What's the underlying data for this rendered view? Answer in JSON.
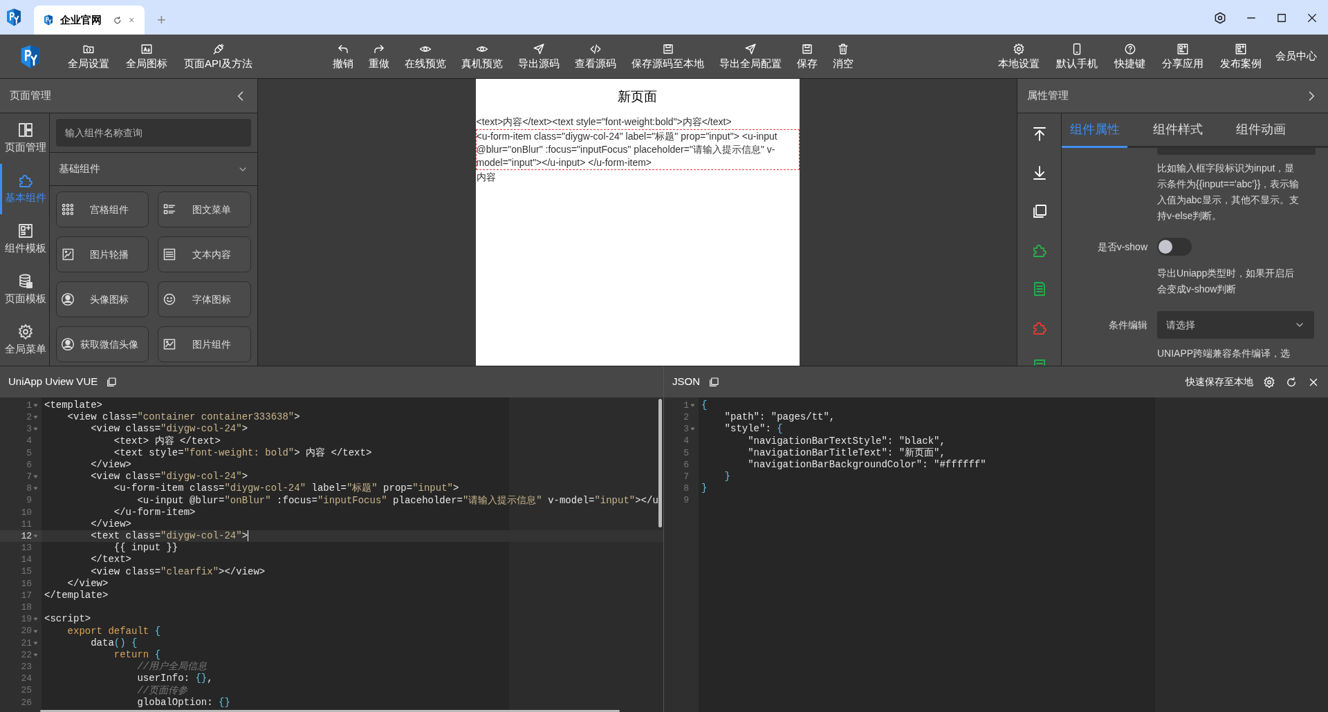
{
  "browser": {
    "tabs": [
      {
        "label": "企业官网",
        "selected": true
      }
    ],
    "new_tab": "+"
  },
  "toolbar": {
    "left": [
      {
        "label": "全局设置"
      },
      {
        "label": "全局图标"
      },
      {
        "label": "页面API及方法"
      }
    ],
    "middle": [
      {
        "label": "撤销"
      },
      {
        "label": "重做"
      },
      {
        "label": "在线预览"
      },
      {
        "label": "真机预览"
      },
      {
        "label": "导出源码"
      },
      {
        "label": "查看源码"
      },
      {
        "label": "保存源码至本地"
      },
      {
        "label": "导出全局配置"
      },
      {
        "label": "保存"
      },
      {
        "label": "消空"
      }
    ],
    "right": [
      {
        "label": "本地设置",
        "kind": "icon"
      },
      {
        "label": "默认手机",
        "kind": "icon"
      },
      {
        "label": "快捷键",
        "kind": "icon"
      },
      {
        "label": "分享应用",
        "kind": "icon"
      },
      {
        "label": "发布案例",
        "kind": "icon"
      },
      {
        "label": "会员中心",
        "kind": "text"
      }
    ]
  },
  "page_panel": {
    "title": "页面管理",
    "nav": [
      {
        "label": "页面管理",
        "selected": false
      },
      {
        "label": "基本组件",
        "selected": true
      },
      {
        "label": "组件模板",
        "selected": false
      },
      {
        "label": "页面模板",
        "selected": false
      },
      {
        "label": "全局菜单",
        "selected": false
      }
    ],
    "search": {
      "placeholder": "输入组件名称查询"
    },
    "group": {
      "title": "基础组件",
      "expanded": true
    },
    "components": [
      {
        "label": "宫格组件"
      },
      {
        "label": "图文菜单"
      },
      {
        "label": "图片轮播"
      },
      {
        "label": "文本内容"
      },
      {
        "label": "头像图标"
      },
      {
        "label": "字体图标"
      },
      {
        "label": "获取微信头像"
      },
      {
        "label": "图片组件"
      }
    ]
  },
  "preview": {
    "title": "新页面",
    "items": [
      {
        "text": "<text>内容</text><text style=\"font-weight:bold\">内容</text>",
        "selected": false
      },
      {
        "text": "<u-form-item class=\"diygw-col-24\" label=\"标题\" prop=\"input\"> <u-input @blur=\"onBlur\" :focus=\"inputFocus\" placeholder=\"请输入提示信息\" v-model=\"input\"></u-input> </u-form-item>",
        "selected": true
      },
      {
        "text": "内容",
        "selected": false
      }
    ]
  },
  "property_panel": {
    "title": "属性管理",
    "tabs": [
      {
        "label": "组件属性",
        "selected": true
      },
      {
        "label": "组件样式",
        "selected": false
      },
      {
        "label": "组件动画",
        "selected": false
      }
    ],
    "hint_1": "比如输入框字段标识为input，显示条件为{{input=='abc'}}，表示输入值为abc显示，其他不显示。支持v-else判断。",
    "vshow": {
      "label": "是否v-show",
      "on": false
    },
    "hint_2": "导出Uniapp类型时，如果开启后会变成v-show判断",
    "condition": {
      "label": "条件编辑",
      "placeholder": "请选择"
    },
    "hint_3": "UNIAPP跨端兼容条件编译，选"
  },
  "vue_editor": {
    "title": "UniApp Uview VUE",
    "lines": [
      {
        "n": "1",
        "fold": true,
        "active": false,
        "tokens": [
          {
            "kind": "plain",
            "text": "<template>"
          }
        ]
      },
      {
        "n": "2",
        "fold": true,
        "active": false,
        "tokens": [
          {
            "kind": "plain",
            "text": "    <view class="
          },
          {
            "kind": "string",
            "text": "\"container container333638\""
          },
          {
            "kind": "plain",
            "text": ">"
          }
        ]
      },
      {
        "n": "3",
        "fold": true,
        "active": false,
        "tokens": [
          {
            "kind": "plain",
            "text": "        <view class="
          },
          {
            "kind": "string",
            "text": "\"diygw-col-24\""
          },
          {
            "kind": "plain",
            "text": ">"
          }
        ]
      },
      {
        "n": "4",
        "fold": false,
        "active": false,
        "tokens": [
          {
            "kind": "plain",
            "text": "            <text> 内容 </text>"
          }
        ]
      },
      {
        "n": "5",
        "fold": false,
        "active": false,
        "tokens": [
          {
            "kind": "plain",
            "text": "            <text style="
          },
          {
            "kind": "string",
            "text": "\"font-weight: bold\""
          },
          {
            "kind": "plain",
            "text": "> 内容 </text>"
          }
        ]
      },
      {
        "n": "6",
        "fold": false,
        "active": false,
        "tokens": [
          {
            "kind": "plain",
            "text": "        </view>"
          }
        ]
      },
      {
        "n": "7",
        "fold": true,
        "active": false,
        "tokens": [
          {
            "kind": "plain",
            "text": "        <view class="
          },
          {
            "kind": "string",
            "text": "\"diygw-col-24\""
          },
          {
            "kind": "plain",
            "text": ">"
          }
        ]
      },
      {
        "n": "8",
        "fold": true,
        "active": false,
        "tokens": [
          {
            "kind": "plain",
            "text": "            <u-form-item class="
          },
          {
            "kind": "string",
            "text": "\"diygw-col-24\""
          },
          {
            "kind": "plain",
            "text": " label="
          },
          {
            "kind": "string",
            "text": "\"标题\""
          },
          {
            "kind": "plain",
            "text": " prop="
          },
          {
            "kind": "string",
            "text": "\"input\""
          },
          {
            "kind": "plain",
            "text": ">"
          }
        ]
      },
      {
        "n": "9",
        "fold": false,
        "active": false,
        "tokens": [
          {
            "kind": "plain",
            "text": "                <u-input @blur="
          },
          {
            "kind": "string",
            "text": "\"onBlur\""
          },
          {
            "kind": "plain",
            "text": " :focus="
          },
          {
            "kind": "string",
            "text": "\"inputFocus\""
          },
          {
            "kind": "plain",
            "text": " placeholder="
          },
          {
            "kind": "string",
            "text": "\"请输入提示信息\""
          },
          {
            "kind": "plain",
            "text": " v-model="
          },
          {
            "kind": "string",
            "text": "\"input\""
          },
          {
            "kind": "plain",
            "text": "></u"
          }
        ]
      },
      {
        "n": "10",
        "fold": false,
        "active": false,
        "tokens": [
          {
            "kind": "plain",
            "text": "            </u-form-item>"
          }
        ]
      },
      {
        "n": "11",
        "fold": false,
        "active": false,
        "tokens": [
          {
            "kind": "plain",
            "text": "        </view>"
          }
        ]
      },
      {
        "n": "12",
        "fold": true,
        "active": true,
        "tokens": [
          {
            "kind": "plain",
            "text": "        <text class="
          },
          {
            "kind": "string",
            "text": "\"diygw-col-24\""
          },
          {
            "kind": "plain",
            "text": ">"
          }
        ]
      },
      {
        "n": "13",
        "fold": false,
        "active": false,
        "tokens": [
          {
            "kind": "plain",
            "text": "            {{ input }}"
          }
        ]
      },
      {
        "n": "14",
        "fold": false,
        "active": false,
        "tokens": [
          {
            "kind": "plain",
            "text": "        </text>"
          }
        ]
      },
      {
        "n": "15",
        "fold": false,
        "active": false,
        "tokens": [
          {
            "kind": "plain",
            "text": "        <view class="
          },
          {
            "kind": "string",
            "text": "\"clearfix\""
          },
          {
            "kind": "plain",
            "text": "></view>"
          }
        ]
      },
      {
        "n": "16",
        "fold": false,
        "active": false,
        "tokens": [
          {
            "kind": "plain",
            "text": "    </view>"
          }
        ]
      },
      {
        "n": "17",
        "fold": false,
        "active": false,
        "tokens": [
          {
            "kind": "plain",
            "text": "</template>"
          }
        ]
      },
      {
        "n": "18",
        "fold": false,
        "active": false
      },
      {
        "n": "19",
        "fold": true,
        "active": false,
        "tokens": [
          {
            "kind": "plain",
            "text": "<script>"
          }
        ]
      },
      {
        "n": "20",
        "fold": true,
        "active": false,
        "tokens": [
          {
            "kind": "keyword",
            "text": "    export default"
          },
          {
            "kind": "brace",
            "text": " {"
          }
        ]
      },
      {
        "n": "21",
        "fold": true,
        "active": false,
        "tokens": [
          {
            "kind": "plain",
            "text": "        data"
          },
          {
            "kind": "brace",
            "text": "() {"
          }
        ]
      },
      {
        "n": "22",
        "fold": true,
        "active": false,
        "tokens": [
          {
            "kind": "keyword",
            "text": "            return"
          },
          {
            "kind": "brace",
            "text": " {"
          }
        ]
      },
      {
        "n": "23",
        "fold": false,
        "active": false,
        "tokens": [
          {
            "kind": "comment",
            "text": "                //用户全局信息"
          }
        ]
      },
      {
        "n": "24",
        "fold": false,
        "active": false,
        "tokens": [
          {
            "kind": "plain",
            "text": "                userInfo: "
          },
          {
            "kind": "brace",
            "text": "{}"
          },
          {
            "kind": "plain",
            "text": ","
          }
        ]
      },
      {
        "n": "25",
        "fold": false,
        "active": false,
        "tokens": [
          {
            "kind": "comment",
            "text": "                //页面传参"
          }
        ]
      },
      {
        "n": "26",
        "fold": false,
        "active": false,
        "tokens": [
          {
            "kind": "plain",
            "text": "                globalOption: "
          },
          {
            "kind": "brace",
            "text": "{}"
          }
        ]
      }
    ]
  },
  "json_editor": {
    "title": "JSON",
    "save_label": "快速保存至本地",
    "lines": [
      {
        "n": "1",
        "fold": true,
        "active": false,
        "tokens": [
          {
            "kind": "brace",
            "text": "{"
          }
        ]
      },
      {
        "n": "2",
        "fold": false,
        "active": false,
        "tokens": [
          {
            "kind": "plain",
            "text": "    \"path\": \"pages/tt\","
          }
        ]
      },
      {
        "n": "3",
        "fold": true,
        "active": false,
        "tokens": [
          {
            "kind": "plain",
            "text": "    \"style\": "
          },
          {
            "kind": "brace",
            "text": "{"
          }
        ]
      },
      {
        "n": "4",
        "fold": false,
        "active": false,
        "tokens": [
          {
            "kind": "plain",
            "text": "        \"navigationBarTextStyle\": \"black\","
          }
        ]
      },
      {
        "n": "5",
        "fold": false,
        "active": false,
        "tokens": [
          {
            "kind": "plain",
            "text": "        \"navigationBarTitleText\": \"新页面\","
          }
        ]
      },
      {
        "n": "6",
        "fold": false,
        "active": false,
        "tokens": [
          {
            "kind": "plain",
            "text": "        \"navigationBarBackgroundColor\": \"#ffffff\""
          }
        ]
      },
      {
        "n": "7",
        "fold": false,
        "active": false,
        "tokens": [
          {
            "kind": "brace",
            "text": "    }"
          }
        ]
      },
      {
        "n": "8",
        "fold": false,
        "active": false,
        "tokens": [
          {
            "kind": "brace",
            "text": "}"
          }
        ]
      },
      {
        "n": "9",
        "fold": false,
        "active": false
      }
    ]
  }
}
